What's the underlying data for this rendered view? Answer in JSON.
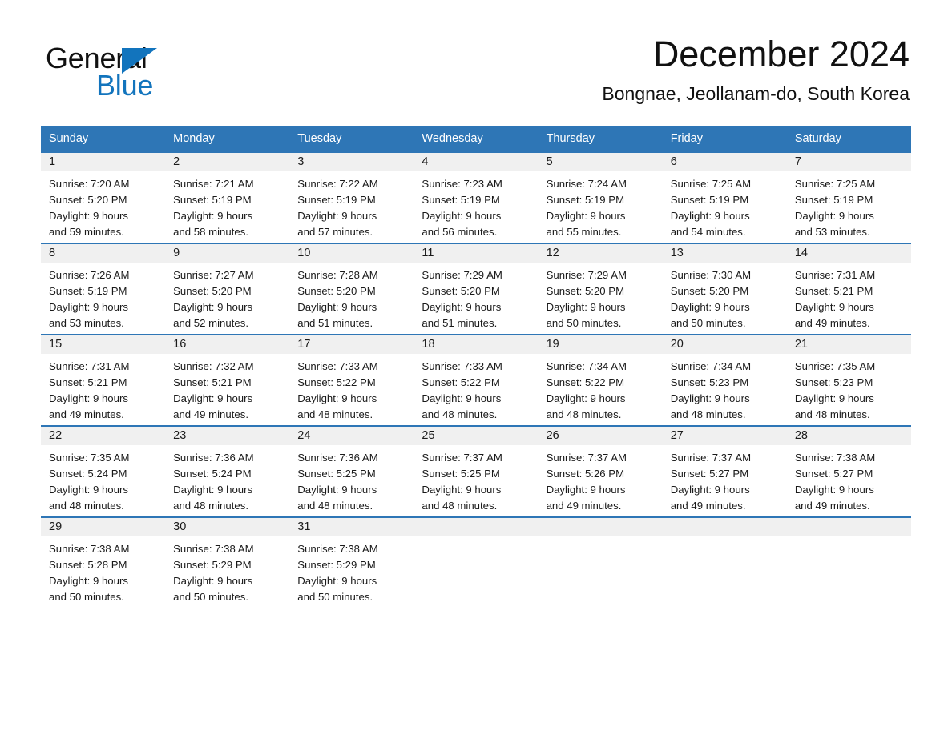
{
  "brand": {
    "name_part1": "General",
    "name_part2": "Blue",
    "logo_colors": {
      "text": "#111111",
      "accent": "#1274bd"
    }
  },
  "header": {
    "title": "December 2024",
    "subtitle": "Bongnae, Jeollanam-do, South Korea"
  },
  "theme": {
    "header_bar": "#2e76b6",
    "row_divider": "#2e76b6",
    "day_strip": "#f0f0f0",
    "text": "#1a1a1a"
  },
  "weekdays": [
    "Sunday",
    "Monday",
    "Tuesday",
    "Wednesday",
    "Thursday",
    "Friday",
    "Saturday"
  ],
  "weeks": [
    {
      "days": [
        {
          "num": "1",
          "sunrise": "Sunrise: 7:20 AM",
          "sunset": "Sunset: 5:20 PM",
          "daylight_line1": "Daylight: 9 hours",
          "daylight_line2": "and 59 minutes."
        },
        {
          "num": "2",
          "sunrise": "Sunrise: 7:21 AM",
          "sunset": "Sunset: 5:19 PM",
          "daylight_line1": "Daylight: 9 hours",
          "daylight_line2": "and 58 minutes."
        },
        {
          "num": "3",
          "sunrise": "Sunrise: 7:22 AM",
          "sunset": "Sunset: 5:19 PM",
          "daylight_line1": "Daylight: 9 hours",
          "daylight_line2": "and 57 minutes."
        },
        {
          "num": "4",
          "sunrise": "Sunrise: 7:23 AM",
          "sunset": "Sunset: 5:19 PM",
          "daylight_line1": "Daylight: 9 hours",
          "daylight_line2": "and 56 minutes."
        },
        {
          "num": "5",
          "sunrise": "Sunrise: 7:24 AM",
          "sunset": "Sunset: 5:19 PM",
          "daylight_line1": "Daylight: 9 hours",
          "daylight_line2": "and 55 minutes."
        },
        {
          "num": "6",
          "sunrise": "Sunrise: 7:25 AM",
          "sunset": "Sunset: 5:19 PM",
          "daylight_line1": "Daylight: 9 hours",
          "daylight_line2": "and 54 minutes."
        },
        {
          "num": "7",
          "sunrise": "Sunrise: 7:25 AM",
          "sunset": "Sunset: 5:19 PM",
          "daylight_line1": "Daylight: 9 hours",
          "daylight_line2": "and 53 minutes."
        }
      ]
    },
    {
      "days": [
        {
          "num": "8",
          "sunrise": "Sunrise: 7:26 AM",
          "sunset": "Sunset: 5:19 PM",
          "daylight_line1": "Daylight: 9 hours",
          "daylight_line2": "and 53 minutes."
        },
        {
          "num": "9",
          "sunrise": "Sunrise: 7:27 AM",
          "sunset": "Sunset: 5:20 PM",
          "daylight_line1": "Daylight: 9 hours",
          "daylight_line2": "and 52 minutes."
        },
        {
          "num": "10",
          "sunrise": "Sunrise: 7:28 AM",
          "sunset": "Sunset: 5:20 PM",
          "daylight_line1": "Daylight: 9 hours",
          "daylight_line2": "and 51 minutes."
        },
        {
          "num": "11",
          "sunrise": "Sunrise: 7:29 AM",
          "sunset": "Sunset: 5:20 PM",
          "daylight_line1": "Daylight: 9 hours",
          "daylight_line2": "and 51 minutes."
        },
        {
          "num": "12",
          "sunrise": "Sunrise: 7:29 AM",
          "sunset": "Sunset: 5:20 PM",
          "daylight_line1": "Daylight: 9 hours",
          "daylight_line2": "and 50 minutes."
        },
        {
          "num": "13",
          "sunrise": "Sunrise: 7:30 AM",
          "sunset": "Sunset: 5:20 PM",
          "daylight_line1": "Daylight: 9 hours",
          "daylight_line2": "and 50 minutes."
        },
        {
          "num": "14",
          "sunrise": "Sunrise: 7:31 AM",
          "sunset": "Sunset: 5:21 PM",
          "daylight_line1": "Daylight: 9 hours",
          "daylight_line2": "and 49 minutes."
        }
      ]
    },
    {
      "days": [
        {
          "num": "15",
          "sunrise": "Sunrise: 7:31 AM",
          "sunset": "Sunset: 5:21 PM",
          "daylight_line1": "Daylight: 9 hours",
          "daylight_line2": "and 49 minutes."
        },
        {
          "num": "16",
          "sunrise": "Sunrise: 7:32 AM",
          "sunset": "Sunset: 5:21 PM",
          "daylight_line1": "Daylight: 9 hours",
          "daylight_line2": "and 49 minutes."
        },
        {
          "num": "17",
          "sunrise": "Sunrise: 7:33 AM",
          "sunset": "Sunset: 5:22 PM",
          "daylight_line1": "Daylight: 9 hours",
          "daylight_line2": "and 48 minutes."
        },
        {
          "num": "18",
          "sunrise": "Sunrise: 7:33 AM",
          "sunset": "Sunset: 5:22 PM",
          "daylight_line1": "Daylight: 9 hours",
          "daylight_line2": "and 48 minutes."
        },
        {
          "num": "19",
          "sunrise": "Sunrise: 7:34 AM",
          "sunset": "Sunset: 5:22 PM",
          "daylight_line1": "Daylight: 9 hours",
          "daylight_line2": "and 48 minutes."
        },
        {
          "num": "20",
          "sunrise": "Sunrise: 7:34 AM",
          "sunset": "Sunset: 5:23 PM",
          "daylight_line1": "Daylight: 9 hours",
          "daylight_line2": "and 48 minutes."
        },
        {
          "num": "21",
          "sunrise": "Sunrise: 7:35 AM",
          "sunset": "Sunset: 5:23 PM",
          "daylight_line1": "Daylight: 9 hours",
          "daylight_line2": "and 48 minutes."
        }
      ]
    },
    {
      "days": [
        {
          "num": "22",
          "sunrise": "Sunrise: 7:35 AM",
          "sunset": "Sunset: 5:24 PM",
          "daylight_line1": "Daylight: 9 hours",
          "daylight_line2": "and 48 minutes."
        },
        {
          "num": "23",
          "sunrise": "Sunrise: 7:36 AM",
          "sunset": "Sunset: 5:24 PM",
          "daylight_line1": "Daylight: 9 hours",
          "daylight_line2": "and 48 minutes."
        },
        {
          "num": "24",
          "sunrise": "Sunrise: 7:36 AM",
          "sunset": "Sunset: 5:25 PM",
          "daylight_line1": "Daylight: 9 hours",
          "daylight_line2": "and 48 minutes."
        },
        {
          "num": "25",
          "sunrise": "Sunrise: 7:37 AM",
          "sunset": "Sunset: 5:25 PM",
          "daylight_line1": "Daylight: 9 hours",
          "daylight_line2": "and 48 minutes."
        },
        {
          "num": "26",
          "sunrise": "Sunrise: 7:37 AM",
          "sunset": "Sunset: 5:26 PM",
          "daylight_line1": "Daylight: 9 hours",
          "daylight_line2": "and 49 minutes."
        },
        {
          "num": "27",
          "sunrise": "Sunrise: 7:37 AM",
          "sunset": "Sunset: 5:27 PM",
          "daylight_line1": "Daylight: 9 hours",
          "daylight_line2": "and 49 minutes."
        },
        {
          "num": "28",
          "sunrise": "Sunrise: 7:38 AM",
          "sunset": "Sunset: 5:27 PM",
          "daylight_line1": "Daylight: 9 hours",
          "daylight_line2": "and 49 minutes."
        }
      ]
    },
    {
      "days": [
        {
          "num": "29",
          "sunrise": "Sunrise: 7:38 AM",
          "sunset": "Sunset: 5:28 PM",
          "daylight_line1": "Daylight: 9 hours",
          "daylight_line2": "and 50 minutes."
        },
        {
          "num": "30",
          "sunrise": "Sunrise: 7:38 AM",
          "sunset": "Sunset: 5:29 PM",
          "daylight_line1": "Daylight: 9 hours",
          "daylight_line2": "and 50 minutes."
        },
        {
          "num": "31",
          "sunrise": "Sunrise: 7:38 AM",
          "sunset": "Sunset: 5:29 PM",
          "daylight_line1": "Daylight: 9 hours",
          "daylight_line2": "and 50 minutes."
        },
        {
          "num": "",
          "sunrise": "",
          "sunset": "",
          "daylight_line1": "",
          "daylight_line2": ""
        },
        {
          "num": "",
          "sunrise": "",
          "sunset": "",
          "daylight_line1": "",
          "daylight_line2": ""
        },
        {
          "num": "",
          "sunrise": "",
          "sunset": "",
          "daylight_line1": "",
          "daylight_line2": ""
        },
        {
          "num": "",
          "sunrise": "",
          "sunset": "",
          "daylight_line1": "",
          "daylight_line2": ""
        }
      ]
    }
  ]
}
